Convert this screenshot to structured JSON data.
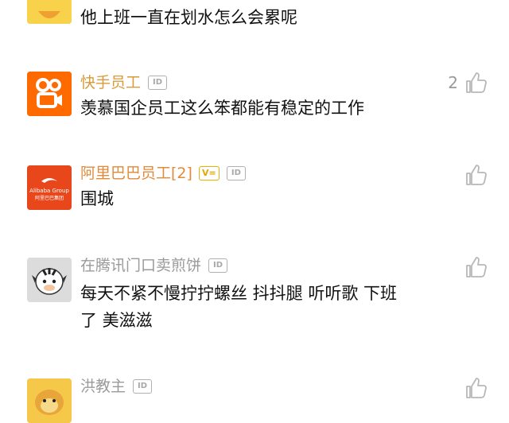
{
  "comments": [
    {
      "name": "",
      "content": "他上班一直在划水怎么会累呢",
      "likes": ""
    },
    {
      "name": "快手员工",
      "name_color": "#d99a3a",
      "id_badge": "ID",
      "content": "羡慕国企员工这么笨都能有稳定的工作",
      "likes": "2"
    },
    {
      "name": "阿里巴巴员工[2]",
      "name_color": "#e08a3a",
      "v_badge": "V=",
      "id_badge": "ID",
      "content": "围城",
      "likes": ""
    },
    {
      "name": "在腾讯门口卖煎饼",
      "name_color": "#9a9a9a",
      "id_badge": "ID",
      "content_line1": "每天不紧不慢拧拧螺丝 抖抖腿 听听歌 下班",
      "content_line2": "了 美滋滋",
      "likes": ""
    },
    {
      "name": "洪教主",
      "name_color": "#9a9a9a",
      "id_badge": "ID",
      "likes": ""
    }
  ],
  "avatars": {
    "kuaishou": {
      "bg": "#ff6a00"
    },
    "alibaba": {
      "bg": "#e8471c",
      "text": "Alibaba Group",
      "subtext": "阿里巴巴集团"
    },
    "zebra": {
      "bg": "#dcdcdc"
    },
    "monkey": {
      "bg": "#f5c84a"
    }
  },
  "colors": {
    "content": "#111111",
    "like_icon": "#b8b8b8"
  }
}
